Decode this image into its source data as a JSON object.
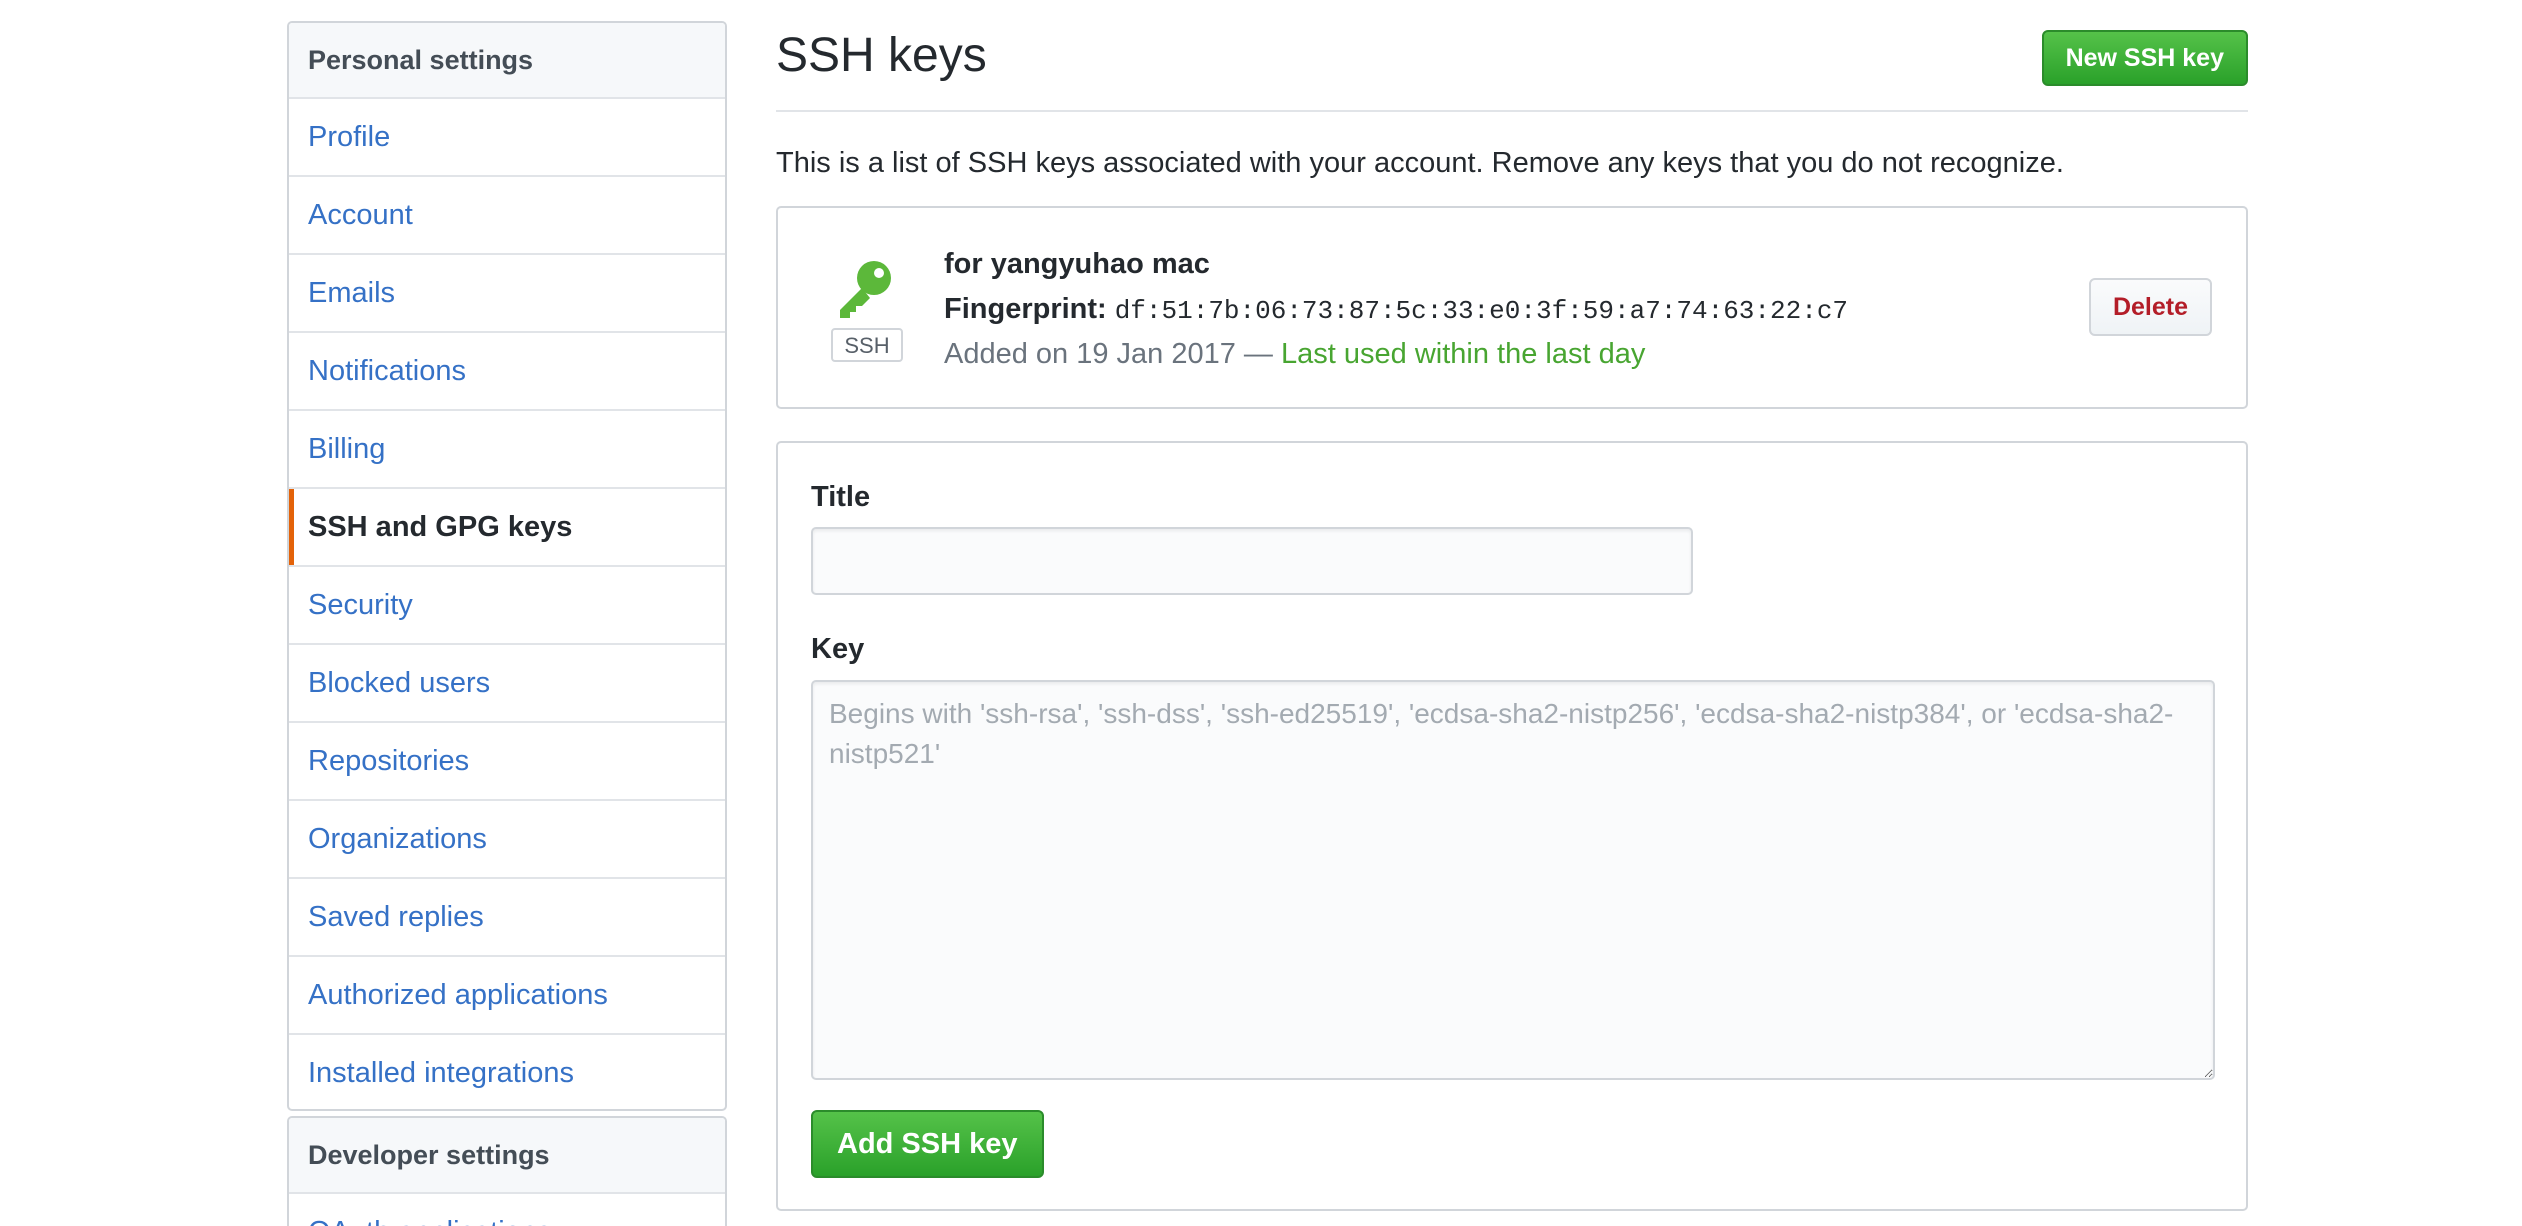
{
  "sidebar": {
    "heading": "Personal settings",
    "items": [
      {
        "label": "Profile"
      },
      {
        "label": "Account"
      },
      {
        "label": "Emails"
      },
      {
        "label": "Notifications"
      },
      {
        "label": "Billing"
      },
      {
        "label": "SSH and GPG keys"
      },
      {
        "label": "Security"
      },
      {
        "label": "Blocked users"
      },
      {
        "label": "Repositories"
      },
      {
        "label": "Organizations"
      },
      {
        "label": "Saved replies"
      },
      {
        "label": "Authorized applications"
      },
      {
        "label": "Installed integrations"
      }
    ],
    "selected_index": 5,
    "developer_heading": "Developer settings",
    "developer_items": [
      {
        "label": "OAuth applications"
      }
    ]
  },
  "main": {
    "title": "SSH keys",
    "new_key_button": "New SSH key",
    "intro": "This is a list of SSH keys associated with your account. Remove any keys that you do not recognize.",
    "keys": [
      {
        "title": "for yangyuhao mac",
        "fingerprint_label": "Fingerprint:",
        "fingerprint": "df:51:7b:06:73:87:5c:33:e0:3f:59:a7:74:63:22:c7",
        "added": "Added on 19 Jan 2017 —",
        "last_used": "Last used within the last day",
        "type_label": "SSH",
        "icon": "key-icon",
        "delete_label": "Delete"
      }
    ],
    "form": {
      "title_label": "Title",
      "title_value": "",
      "key_label": "Key",
      "key_placeholder": "Begins with 'ssh-rsa', 'ssh-dss', 'ssh-ed25519', 'ecdsa-sha2-nistp256', 'ecdsa-sha2-nistp384', or 'ecdsa-sha2-nistp521'",
      "submit_label": "Add SSH key"
    }
  },
  "colors": {
    "link": "#3571c6",
    "selected_indicator": "#e36209",
    "green": "#2aa12a",
    "key_icon": "#5cb83a",
    "recent": "#48a531",
    "danger": "#b31d28"
  }
}
